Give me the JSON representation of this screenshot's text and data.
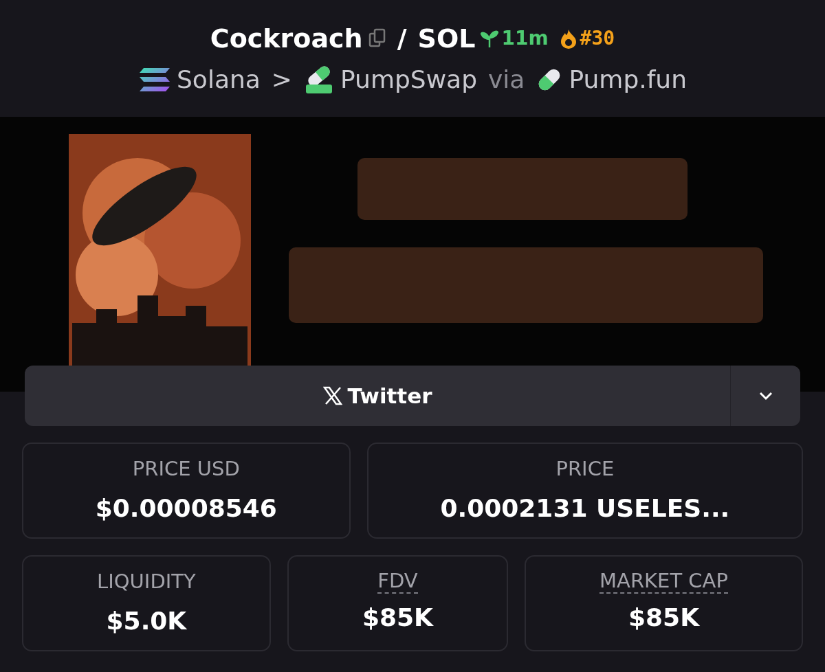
{
  "header": {
    "token": "Cockroach",
    "separator": "/",
    "quote": "SOL",
    "age": "11m",
    "rank": "#30"
  },
  "route": {
    "chain": "Solana",
    "separator": ">",
    "dex": "PumpSwap",
    "via": "via",
    "launchpad": "Pump.fun"
  },
  "banner": {
    "kind": "picture"
  },
  "social_button": {
    "label": "Twitter"
  },
  "stats": [
    [
      {
        "label": "PRICE USD",
        "value": "$0.00008546",
        "underlined": false
      },
      {
        "label": "PRICE",
        "value": "0.0002131 USELES...",
        "underlined": false
      }
    ],
    [
      {
        "label": "LIQUIDITY",
        "value": "$5.0K",
        "underlined": false
      },
      {
        "label": "FDV",
        "value": "$85K",
        "underlined": true
      },
      {
        "label": "MARKET CAP",
        "value": "$85K",
        "underlined": true
      }
    ]
  ]
}
